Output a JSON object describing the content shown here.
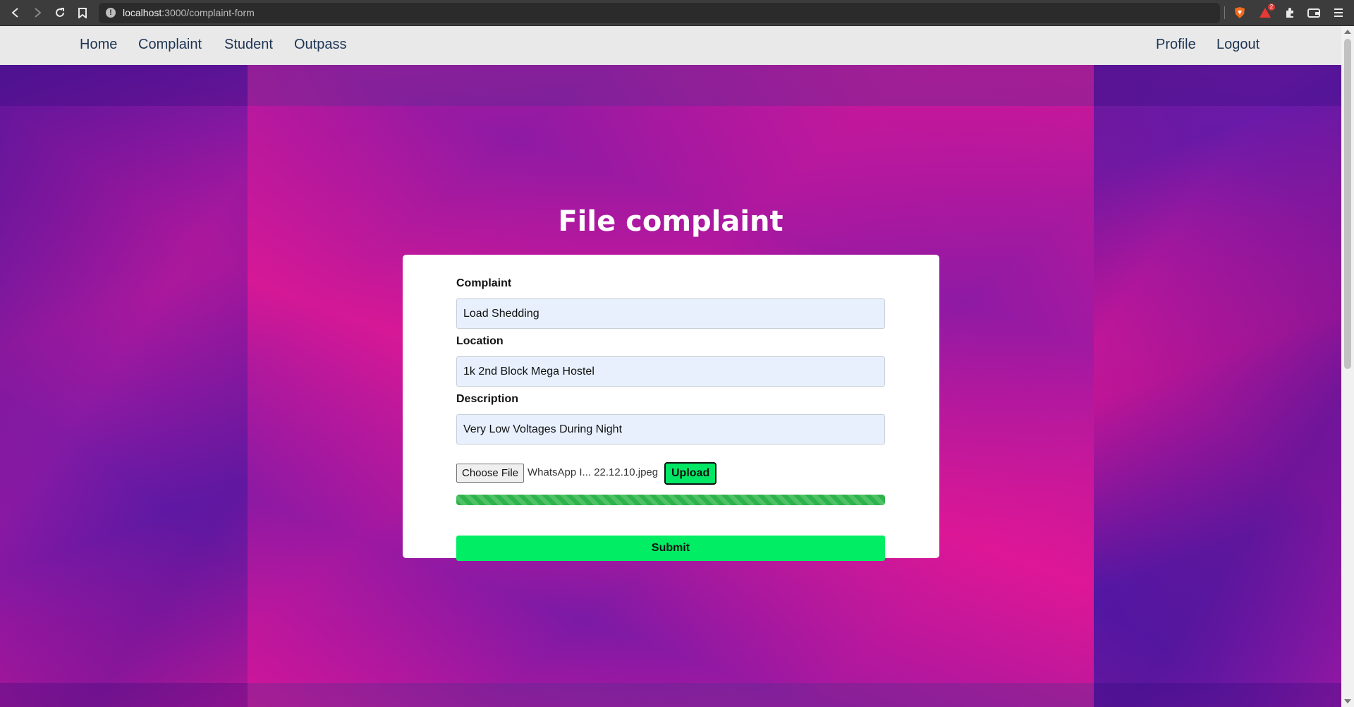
{
  "browser": {
    "url_host": "localhost",
    "url_path": ":3000/complaint-form",
    "extension_badge": "2"
  },
  "nav": {
    "left": [
      "Home",
      "Complaint",
      "Student",
      "Outpass"
    ],
    "right": [
      "Profile",
      "Logout"
    ]
  },
  "page": {
    "title": "File complaint"
  },
  "form": {
    "complaint_label": "Complaint",
    "complaint_value": "Load Shedding",
    "location_label": "Location",
    "location_value": "1k 2nd Block Mega Hostel",
    "description_label": "Description",
    "description_value": "Very Low Voltages During Night",
    "choose_file_label": "Choose File",
    "file_name": "WhatsApp I... 22.12.10.jpeg",
    "upload_label": "Upload",
    "upload_progress_percent": 100,
    "submit_label": "Submit"
  },
  "colors": {
    "accent_green": "#00ed64",
    "nav_text": "#1f3554",
    "background_purple": "#6a1aa8",
    "background_pink": "#c8179a"
  }
}
